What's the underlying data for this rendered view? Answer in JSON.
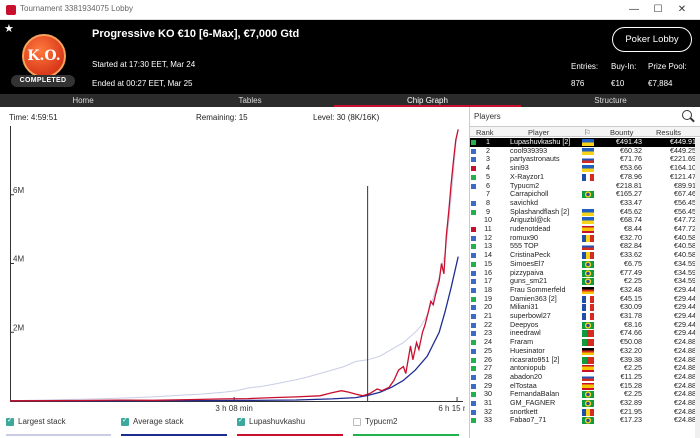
{
  "window": {
    "title": "Tournament 3381934075 Lobby"
  },
  "header": {
    "badge_text": "K.O.",
    "status": "COMPLETED",
    "title": "Progressive KO €10 [6-Max], €7,000 Gtd",
    "started": "Started at 17:30 EET, Mar 24",
    "ended": "Ended at 00:27 EET, Mar 25",
    "lobby_button": "Poker Lobby",
    "stats": [
      {
        "label": "Entries:",
        "value": "876"
      },
      {
        "label": "Buy-In:",
        "value": "€10"
      },
      {
        "label": "Prize Pool:",
        "value": "€7,884"
      }
    ]
  },
  "tabs": [
    "Home",
    "Tables",
    "Chip Graph",
    "Structure"
  ],
  "active_tab": "Chip Graph",
  "chart_info": {
    "time": "Time: 4:59:51",
    "remaining": "Remaining: 15",
    "level": "Level: 30 (8K/16K)"
  },
  "chart_data": {
    "type": "line",
    "y_ticks": [
      "2M",
      "4M",
      "6M"
    ],
    "y_tick_values": [
      2000000,
      4000000,
      6000000
    ],
    "ylim": [
      0,
      8000000
    ],
    "x_ticks": [
      "3 h 08 min",
      "6 h 15 min"
    ],
    "x_tick_values": [
      188,
      375
    ],
    "xlim": [
      0,
      380
    ],
    "cursor_x": 300,
    "series": [
      {
        "name": "Largest stack",
        "color": "#c9cde6",
        "checked": true,
        "points": [
          [
            0,
            10000
          ],
          [
            20,
            20000
          ],
          [
            40,
            35000
          ],
          [
            60,
            50000
          ],
          [
            80,
            70000
          ],
          [
            100,
            90000
          ],
          [
            120,
            120000
          ],
          [
            140,
            160000
          ],
          [
            160,
            200000
          ],
          [
            180,
            260000
          ],
          [
            190,
            300000
          ],
          [
            200,
            380000
          ],
          [
            210,
            420000
          ],
          [
            220,
            480000
          ],
          [
            230,
            550000
          ],
          [
            240,
            620000
          ],
          [
            250,
            700000
          ],
          [
            260,
            800000
          ],
          [
            270,
            900000
          ],
          [
            280,
            1000000
          ],
          [
            290,
            1150000
          ],
          [
            300,
            1200000
          ],
          [
            310,
            1300000
          ],
          [
            320,
            1500000
          ],
          [
            330,
            1700000
          ],
          [
            340,
            2000000
          ],
          [
            345,
            2200000
          ],
          [
            350,
            2500000
          ],
          [
            355,
            3000000
          ],
          [
            360,
            3600000
          ],
          [
            365,
            4300000
          ],
          [
            368,
            5200000
          ],
          [
            371,
            6300000
          ],
          [
            374,
            7500000
          ],
          [
            376,
            7900000
          ]
        ]
      },
      {
        "name": "Average stack",
        "color": "#1f2c8f",
        "checked": true,
        "points": [
          [
            0,
            5000
          ],
          [
            50,
            6000
          ],
          [
            100,
            8000
          ],
          [
            150,
            12000
          ],
          [
            200,
            18000
          ],
          [
            240,
            30000
          ],
          [
            270,
            60000
          ],
          [
            290,
            100000
          ],
          [
            300,
            160000
          ],
          [
            310,
            250000
          ],
          [
            320,
            400000
          ],
          [
            330,
            600000
          ],
          [
            340,
            900000
          ],
          [
            350,
            1300000
          ],
          [
            360,
            2000000
          ],
          [
            365,
            2600000
          ],
          [
            370,
            3300000
          ],
          [
            376,
            4200000
          ]
        ]
      },
      {
        "name": "Lupashuvkashu",
        "color": "#c8102e",
        "checked": true,
        "points": [
          [
            0,
            5000
          ],
          [
            30,
            8000
          ],
          [
            60,
            15000
          ],
          [
            90,
            25000
          ],
          [
            120,
            20000
          ],
          [
            150,
            40000
          ],
          [
            180,
            60000
          ],
          [
            200,
            70000
          ],
          [
            220,
            100000
          ],
          [
            240,
            120000
          ],
          [
            260,
            150000
          ],
          [
            270,
            240000
          ],
          [
            278,
            300000
          ],
          [
            284,
            260000
          ],
          [
            290,
            200000
          ],
          [
            296,
            150000
          ],
          [
            302,
            220000
          ],
          [
            308,
            350000
          ],
          [
            312,
            300000
          ],
          [
            318,
            400000
          ],
          [
            322,
            600000
          ],
          [
            326,
            900000
          ],
          [
            330,
            1000000
          ],
          [
            332,
            800000
          ],
          [
            336,
            1600000
          ],
          [
            338,
            1200000
          ],
          [
            341,
            1700000
          ],
          [
            343,
            1500000
          ],
          [
            346,
            2000000
          ],
          [
            348,
            2200000
          ],
          [
            351,
            2600000
          ],
          [
            353,
            2900000
          ],
          [
            355,
            2800000
          ],
          [
            357,
            3100000
          ],
          [
            360,
            3500000
          ],
          [
            362,
            4000000
          ],
          [
            364,
            3700000
          ],
          [
            366,
            4800000
          ],
          [
            368,
            5500000
          ],
          [
            370,
            6300000
          ],
          [
            372,
            7000000
          ],
          [
            374,
            7600000
          ],
          [
            376,
            7900000
          ]
        ]
      },
      {
        "name": "Typucm2",
        "color": "#22b14c",
        "checked": false,
        "points": []
      }
    ]
  },
  "players": {
    "header": "Players",
    "columns": [
      "Rank",
      "Player",
      "Bounty",
      "Results"
    ],
    "rows": [
      {
        "rank": "1",
        "name": "Lupashuvkashu [2]",
        "bounty": "€491.43",
        "result": "€449.91",
        "sq": "#22b14c",
        "flag": "ua",
        "highlight": true
      },
      {
        "rank": "2",
        "name": "cool939393",
        "bounty": "€60.32",
        "result": "€449.25",
        "sq": "#3a6bc8",
        "flag": "ua"
      },
      {
        "rank": "3",
        "name": "partyastronauts",
        "bounty": "€71.76",
        "result": "€221.69",
        "sq": "#3a6bc8",
        "flag": "ru"
      },
      {
        "rank": "4",
        "name": "sini93",
        "bounty": "€53.66",
        "result": "€164.10",
        "sq": "#c8102e",
        "flag": "ua"
      },
      {
        "rank": "5",
        "name": "X-Rayzor1",
        "bounty": "€78.96",
        "result": "€121.47",
        "sq": "#22b14c",
        "flag": "fr"
      },
      {
        "rank": "6",
        "name": "Typucm2",
        "bounty": "€218.81",
        "result": "€89.91",
        "sq": "#3a6bc8",
        "flag": "none"
      },
      {
        "rank": "7",
        "name": "Carrapicholl",
        "bounty": "€165.27",
        "result": "€67.46",
        "sq": "#ffffff",
        "flag": "br"
      },
      {
        "rank": "8",
        "name": "savichkd",
        "bounty": "€33.47",
        "result": "€56.45",
        "sq": "#3a6bc8",
        "flag": "none"
      },
      {
        "rank": "9",
        "name": "Splashandflash [2]",
        "bounty": "€45.62",
        "result": "€56.45",
        "sq": "#22b14c",
        "flag": "ua"
      },
      {
        "rank": "10",
        "name": "Ariguzbl@ck",
        "bounty": "€68.74",
        "result": "€47.72",
        "sq": "#ffffff",
        "flag": "ua"
      },
      {
        "rank": "11",
        "name": "rudenotdead",
        "bounty": "€8.44",
        "result": "€47.72",
        "sq": "#c8102e",
        "flag": "es"
      },
      {
        "rank": "12",
        "name": "romux90",
        "bounty": "€32.70",
        "result": "€40.58",
        "sq": "#3a6bc8",
        "flag": "ro"
      },
      {
        "rank": "13",
        "name": "555 TOP",
        "bounty": "€82.84",
        "result": "€40.58",
        "sq": "#22b14c",
        "flag": "ru"
      },
      {
        "rank": "14",
        "name": "CristinaPeck",
        "bounty": "€33.62",
        "result": "€40.58",
        "sq": "#3a6bc8",
        "flag": "ro"
      },
      {
        "rank": "15",
        "name": "SimoesEl7",
        "bounty": "€6.75",
        "result": "€34.59",
        "sq": "#22b14c",
        "flag": "br"
      },
      {
        "rank": "16",
        "name": "pizzypaiva",
        "bounty": "€77.49",
        "result": "€34.59",
        "sq": "#3a6bc8",
        "flag": "br"
      },
      {
        "rank": "17",
        "name": "guns_sm21",
        "bounty": "€2.25",
        "result": "€34.59",
        "sq": "#3a6bc8",
        "flag": "br"
      },
      {
        "rank": "18",
        "name": "Frau Sommerfeld",
        "bounty": "€32.48",
        "result": "€29.44",
        "sq": "#3a6bc8",
        "flag": "de"
      },
      {
        "rank": "19",
        "name": "Damien363 [2]",
        "bounty": "€45.15",
        "result": "€29.44",
        "sq": "#22b14c",
        "flag": "fr"
      },
      {
        "rank": "20",
        "name": "Miliani31",
        "bounty": "€30.09",
        "result": "€29.44",
        "sq": "#3a6bc8",
        "flag": "fr"
      },
      {
        "rank": "21",
        "name": "superbowl27",
        "bounty": "€31.78",
        "result": "€29.44",
        "sq": "#3a6bc8",
        "flag": "fr"
      },
      {
        "rank": "22",
        "name": "Deepyos",
        "bounty": "€8.16",
        "result": "€29.44",
        "sq": "#3a6bc8",
        "flag": "br"
      },
      {
        "rank": "23",
        "name": "ineedrawl",
        "bounty": "€74.66",
        "result": "€29.44",
        "sq": "#3a6bc8",
        "flag": "pt"
      },
      {
        "rank": "24",
        "name": "Fraram",
        "bounty": "€50.08",
        "result": "€24.88",
        "sq": "#22b14c",
        "flag": "pt"
      },
      {
        "rank": "25",
        "name": "Huesinator",
        "bounty": "€32.20",
        "result": "€24.88",
        "sq": "#3a6bc8",
        "flag": "de"
      },
      {
        "rank": "26",
        "name": "ricasrato951 [2]",
        "bounty": "€39.38",
        "result": "€24.88",
        "sq": "#22b14c",
        "flag": "pt"
      },
      {
        "rank": "27",
        "name": "antoniopub",
        "bounty": "€2.25",
        "result": "€24.88",
        "sq": "#22b14c",
        "flag": "es"
      },
      {
        "rank": "28",
        "name": "abadon20",
        "bounty": "€11.25",
        "result": "€24.88",
        "sq": "#3a6bc8",
        "flag": "ru"
      },
      {
        "rank": "29",
        "name": "elTostaa",
        "bounty": "€15.28",
        "result": "€24.88",
        "sq": "#3a6bc8",
        "flag": "es"
      },
      {
        "rank": "30",
        "name": "FernandaBalan",
        "bounty": "€2.25",
        "result": "€24.88",
        "sq": "#22b14c",
        "flag": "br"
      },
      {
        "rank": "31",
        "name": "GM_FAGNER",
        "bounty": "€32.89",
        "result": "€24.88",
        "sq": "#3a6bc8",
        "flag": "br"
      },
      {
        "rank": "32",
        "name": "snortkett",
        "bounty": "€21.95",
        "result": "€24.88",
        "sq": "#3a6bc8",
        "flag": "ro"
      },
      {
        "rank": "33",
        "name": "Fabao7_71",
        "bounty": "€17.23",
        "result": "€24.88",
        "sq": "#22b14c",
        "flag": "br"
      }
    ]
  }
}
